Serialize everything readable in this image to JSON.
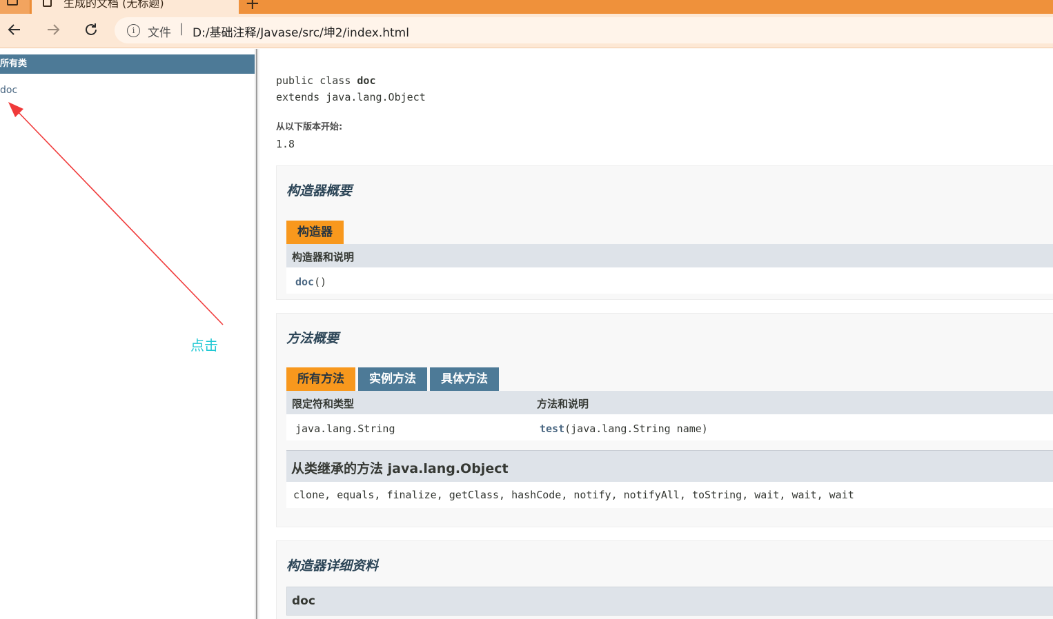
{
  "browser": {
    "tab_title": "生成的文档 (无标题)",
    "new_tab": "+",
    "address_label": "文件",
    "address_separator": "|",
    "url": "D:/基础注释/Javase/src/坤2/index.html"
  },
  "left_frame": {
    "header": "所有类",
    "class_link": "doc",
    "annotation": "点击",
    "annotation_color": "#20c8d4",
    "arrow_color": "#f03a3a"
  },
  "content": {
    "signature_prefix": "public class ",
    "class_name": "doc",
    "extends_line": "extends java.lang.Object",
    "since_label": "从以下版本开始:",
    "since_value": "1.8",
    "constructor_summary": {
      "title": "构造器概要",
      "tab": "构造器",
      "column": "构造器和说明",
      "rows": [
        {
          "name": "doc",
          "params": "()"
        }
      ]
    },
    "method_summary": {
      "title": "方法概要",
      "tabs": [
        "所有方法",
        "实例方法",
        "具体方法"
      ],
      "columns": [
        "限定符和类型",
        "方法和说明"
      ],
      "rows": [
        {
          "type": "java.lang.String",
          "name": "test",
          "params": "(java.lang.String  name)"
        }
      ],
      "inherited_title": "从类继承的方法 java.lang.Object",
      "inherited_methods": "clone, equals, finalize, getClass, hashCode, notify, notifyAll, toString, wait, wait, wait"
    },
    "constructor_detail": {
      "title": "构造器详细资料",
      "item": "doc"
    }
  },
  "colors": {
    "header_blue": "#4d7a97",
    "tab_orange": "#f8981d",
    "table_header": "#dee3e9",
    "browser_orange": "#ef913b"
  }
}
